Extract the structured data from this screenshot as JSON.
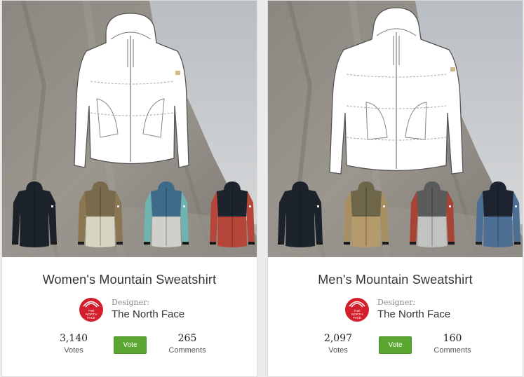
{
  "cards": [
    {
      "title": "Women's Mountain Sweatshirt",
      "designer_label": "Designer:",
      "designer_name": "The North Face",
      "logo_text": [
        "THE",
        "NORTH",
        "FACE"
      ],
      "votes_count": "3,140",
      "votes_label": "Votes",
      "vote_button": "Vote",
      "comments_count": "265",
      "comments_label": "Comments",
      "colorways": [
        {
          "top": "#1c222a",
          "bottom": "#1c222a",
          "sleeve": "#1c222a"
        },
        {
          "top": "#7a6a4c",
          "bottom": "#d8d4c2",
          "sleeve": "#8a7650"
        },
        {
          "top": "#3e6b8a",
          "bottom": "#cfd0cb",
          "sleeve": "#6fb4b1"
        },
        {
          "top": "#1d232c",
          "bottom": "#b6463a",
          "sleeve": "#b6463a"
        }
      ]
    },
    {
      "title": "Men's Mountain Sweatshirt",
      "designer_label": "Designer:",
      "designer_name": "The North Face",
      "logo_text": [
        "THE",
        "NORTH",
        "FACE"
      ],
      "votes_count": "2,097",
      "votes_label": "Votes",
      "vote_button": "Vote",
      "comments_count": "160",
      "comments_label": "Comments",
      "colorways": [
        {
          "top": "#1c222a",
          "bottom": "#1c222a",
          "sleeve": "#1c222a"
        },
        {
          "top": "#6e6648",
          "bottom": "#b59a6c",
          "sleeve": "#a88f62"
        },
        {
          "top": "#5a5c5c",
          "bottom": "#c2c2c0",
          "sleeve": "#a94434"
        },
        {
          "top": "#1d2430",
          "bottom": "#4d6f93",
          "sleeve": "#4d6f93"
        }
      ]
    }
  ],
  "colors": {
    "vote_green": "#5aa630",
    "logo_red": "#d21f2b",
    "sky": "#c9cdd0",
    "rock": "#8d8a84"
  }
}
